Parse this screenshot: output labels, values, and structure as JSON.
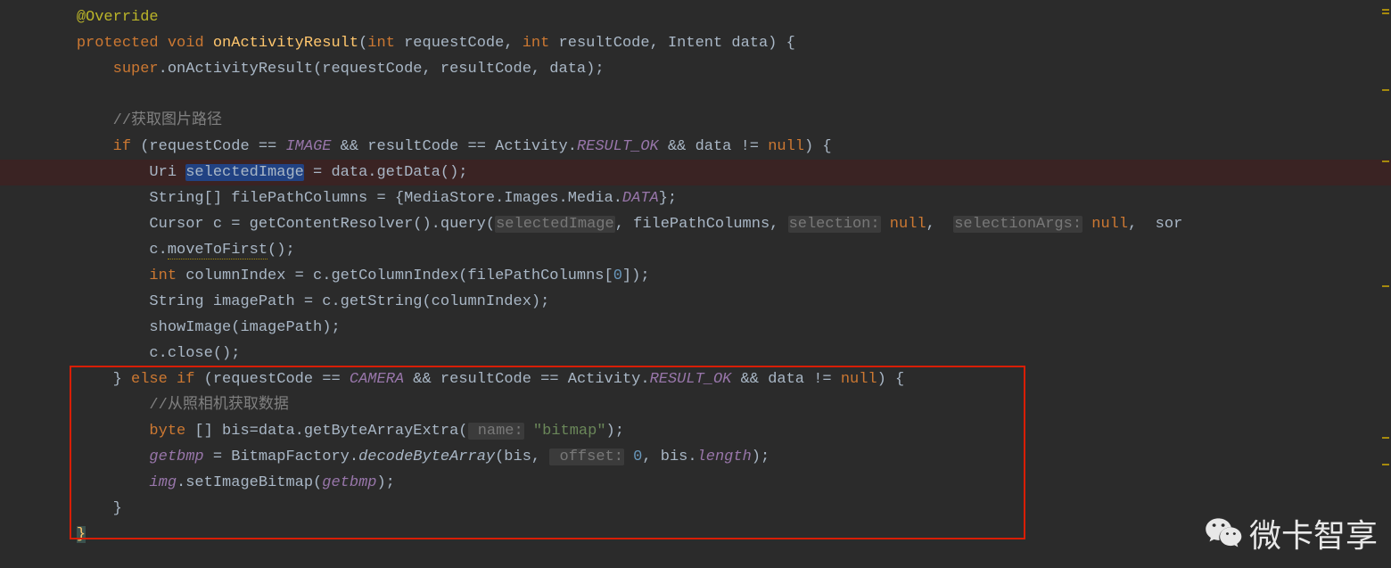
{
  "code": {
    "l1": "@Override",
    "l2a": "protected",
    "l2b": "void",
    "l2c": "onActivityResult",
    "l2d": "int",
    "l2e": "requestCode,",
    "l2f": "int",
    "l2g": "resultCode, Intent data) {",
    "l3a": "super",
    "l3b": ".onActivityResult(requestCode, resultCode, data);",
    "l4": "",
    "l5": "//获取图片路径",
    "l6a": "if",
    "l6b": " (requestCode == ",
    "l6c": "IMAGE",
    "l6d": " && resultCode == Activity.",
    "l6e": "RESULT_OK",
    "l6f": " && data != ",
    "l6g": "null",
    "l6h": ") {",
    "l7a": "Uri ",
    "l7b": "selectedImage",
    "l7c": " = data.getData();",
    "l8a": "String[] filePathColumns = {MediaStore.Images.Media.",
    "l8b": "DATA",
    "l8c": "};",
    "l9a": "Cursor c = getContentResolver().query(",
    "l9b": "selectedImage",
    "l9c": ", filePathColumns, ",
    "l9d": "selection:",
    "l9e": " null",
    "l9f": ", ",
    "l9g": "selectionArgs:",
    "l9h": " null",
    "l9i": ", ",
    "l9j": "sor",
    "l10a": "c.",
    "l10b": "moveToFirst",
    "l10c": "();",
    "l11a": "int",
    "l11b": " columnIndex = c.getColumnIndex(filePathColumns[",
    "l11c": "0",
    "l11d": "]);",
    "l12": "String imagePath = c.getString(columnIndex);",
    "l13": "showImage(imagePath);",
    "l14": "c.close();",
    "l15a": "} ",
    "l15b": "else if",
    "l15c": " (requestCode == ",
    "l15d": "CAMERA",
    "l15e": " && resultCode == Activity.",
    "l15f": "RESULT_OK",
    "l15g": " && data != ",
    "l15h": "null",
    "l15i": ") {",
    "l16": "//从照相机获取数据",
    "l17a": "byte",
    "l17b": " [] bis=data.getByteArrayExtra(",
    "l17c": " name:",
    "l17d": " \"bitmap\"",
    "l17e": ");",
    "l18a": "getbmp",
    "l18b": " = BitmapFactory.",
    "l18c": "decodeByteArray",
    "l18d": "(bis, ",
    "l18e": " offset:",
    "l18f": " 0",
    "l18g": ", bis.",
    "l18h": "length",
    "l18i": ");",
    "l19a": "img",
    "l19b": ".setImageBitmap(",
    "l19c": "getbmp",
    "l19d": ");",
    "l20": "}",
    "l21": "}"
  },
  "watermark": "微卡智享"
}
